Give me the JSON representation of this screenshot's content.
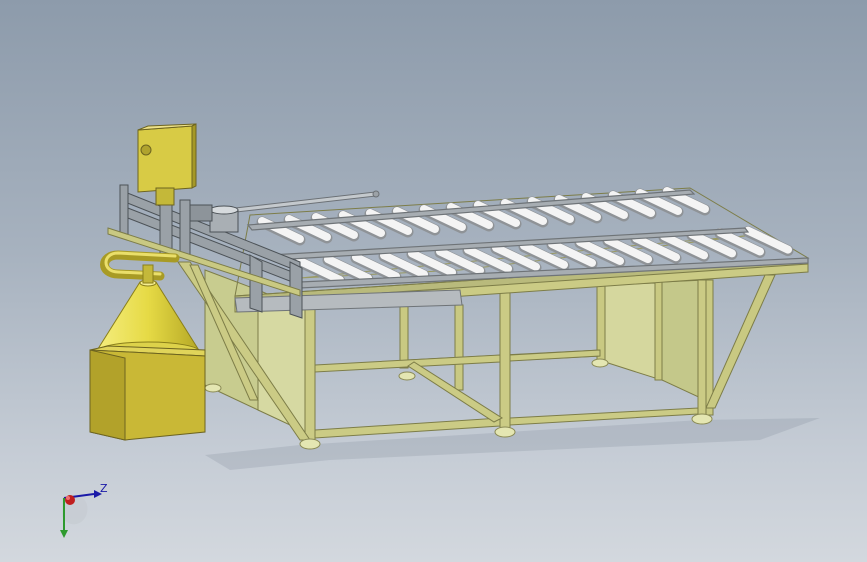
{
  "viewport": {
    "background_top": "#8d9bab",
    "background_bottom": "#d3d8de"
  },
  "model": {
    "frame_color": "#c9c982",
    "frame_dark": "#8e8e55",
    "panel_color": "#c8cc8f",
    "roller_color": "#f2f2f2",
    "rail_color": "#9aa0a6",
    "hopper_color": "#e8df55",
    "box_color": "#c9b836",
    "cabinet_color": "#d8cb45"
  },
  "triad": {
    "z_label": "Z",
    "z_color": "#1a1aa8",
    "y_color": "#2e9a2e",
    "x_color": "#c01e1e"
  }
}
